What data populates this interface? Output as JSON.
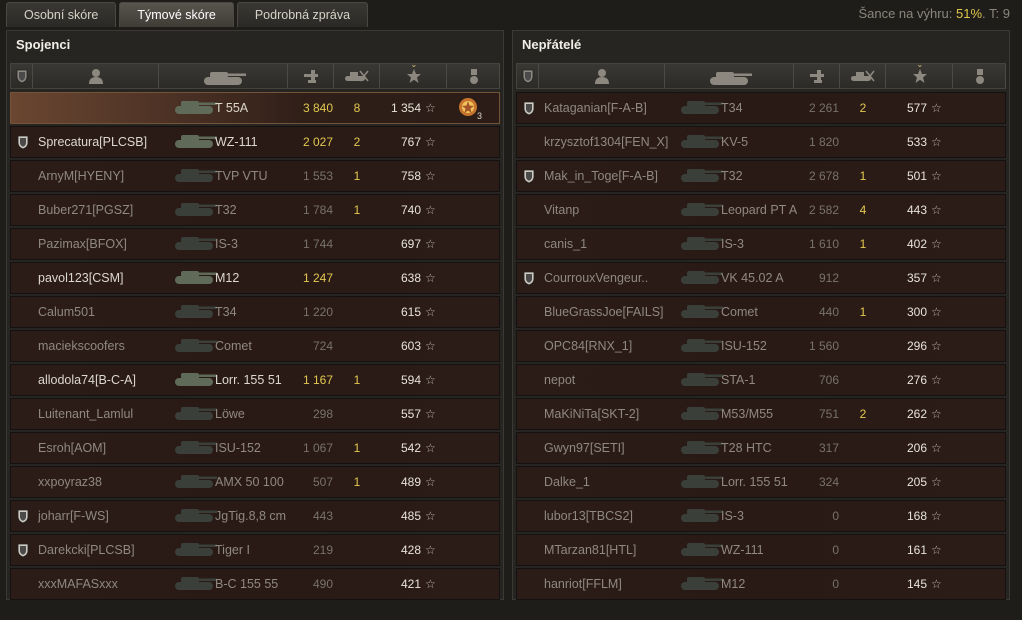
{
  "tabs": [
    {
      "label": "Osobní skóre",
      "active": false
    },
    {
      "label": "Týmové skóre",
      "active": true
    },
    {
      "label": "Podrobná zpráva",
      "active": false
    }
  ],
  "win_chance": {
    "label": "Šance na výhru: ",
    "value": "51%",
    "suffix": ". T: 9"
  },
  "left": {
    "title": "Spojenci",
    "rows": [
      {
        "name": "",
        "tank": "T 55A",
        "damage": "3 840",
        "kills": "8",
        "xp": "1 354",
        "clan_badge": false,
        "alive": true,
        "player": true,
        "medal": "3"
      },
      {
        "name": "Sprecatura[PLCSB]",
        "tank": "WZ-111",
        "damage": "2 027",
        "kills": "2",
        "xp": "767",
        "clan_badge": true,
        "alive": true
      },
      {
        "name": "ArnyM[HYENY]",
        "tank": "TVP VTU",
        "damage": "1 553",
        "kills": "1",
        "xp": "758",
        "clan_badge": false,
        "alive": false
      },
      {
        "name": "Buber271[PGSZ]",
        "tank": "T32",
        "damage": "1 784",
        "kills": "1",
        "xp": "740",
        "clan_badge": false,
        "alive": false
      },
      {
        "name": "Pazimax[BFOX]",
        "tank": "IS-3",
        "damage": "1 744",
        "kills": "",
        "xp": "697",
        "clan_badge": false,
        "alive": false
      },
      {
        "name": "pavol123[CSM]",
        "tank": "M12",
        "damage": "1 247",
        "kills": "",
        "xp": "638",
        "clan_badge": false,
        "alive": true
      },
      {
        "name": "Calum501",
        "tank": "T34",
        "damage": "1 220",
        "kills": "",
        "xp": "615",
        "clan_badge": false,
        "alive": false
      },
      {
        "name": "maciekscoofers",
        "tank": "Comet",
        "damage": "724",
        "kills": "",
        "xp": "603",
        "clan_badge": false,
        "alive": false
      },
      {
        "name": "allodola74[B-C-A]",
        "tank": "Lorr. 155 51",
        "damage": "1 167",
        "kills": "1",
        "xp": "594",
        "clan_badge": false,
        "alive": true
      },
      {
        "name": "Luitenant_Lamlul",
        "tank": "Löwe",
        "damage": "298",
        "kills": "",
        "xp": "557",
        "clan_badge": false,
        "alive": false
      },
      {
        "name": "Esroh[AOM]",
        "tank": "ISU-152",
        "damage": "1 067",
        "kills": "1",
        "xp": "542",
        "clan_badge": false,
        "alive": false
      },
      {
        "name": "xxpoyraz38",
        "tank": "AMX 50 100",
        "damage": "507",
        "kills": "1",
        "xp": "489",
        "clan_badge": false,
        "alive": false
      },
      {
        "name": "joharr[F-WS]",
        "tank": "JgTig.8,8 cm",
        "damage": "443",
        "kills": "",
        "xp": "485",
        "clan_badge": true,
        "alive": false
      },
      {
        "name": "Darekcki[PLCSB]",
        "tank": "Tiger I",
        "damage": "219",
        "kills": "",
        "xp": "428",
        "clan_badge": true,
        "alive": false
      },
      {
        "name": "xxxMAFASxxx",
        "tank": "B-C 155 55",
        "damage": "490",
        "kills": "",
        "xp": "421",
        "clan_badge": false,
        "alive": false
      }
    ]
  },
  "right": {
    "title": "Nepřátelé",
    "rows": [
      {
        "name": "Kataganian[F-A-B]",
        "tank": "T34",
        "damage": "2 261",
        "kills": "2",
        "xp": "577",
        "clan_badge": true,
        "alive": false
      },
      {
        "name": "krzysztof1304[FEN_X]",
        "tank": "KV-5",
        "damage": "1 820",
        "kills": "",
        "xp": "533",
        "clan_badge": false,
        "alive": false
      },
      {
        "name": "Mak_in_Toge[F-A-B]",
        "tank": "T32",
        "damage": "2 678",
        "kills": "1",
        "xp": "501",
        "clan_badge": true,
        "alive": false
      },
      {
        "name": "Vitanp",
        "tank": "Leopard PT A",
        "damage": "2 582",
        "kills": "4",
        "xp": "443",
        "clan_badge": false,
        "alive": false
      },
      {
        "name": "canis_1",
        "tank": "IS-3",
        "damage": "1 610",
        "kills": "1",
        "xp": "402",
        "clan_badge": false,
        "alive": false
      },
      {
        "name": "CourrouxVengeur..",
        "tank": "VK 45.02 A",
        "damage": "912",
        "kills": "",
        "xp": "357",
        "clan_badge": true,
        "alive": false
      },
      {
        "name": "BlueGrassJoe[FAILS]",
        "tank": "Comet",
        "damage": "440",
        "kills": "1",
        "xp": "300",
        "clan_badge": false,
        "alive": false
      },
      {
        "name": "OPC84[RNX_1]",
        "tank": "ISU-152",
        "damage": "1 560",
        "kills": "",
        "xp": "296",
        "clan_badge": false,
        "alive": false
      },
      {
        "name": "nepot",
        "tank": "STA-1",
        "damage": "706",
        "kills": "",
        "xp": "276",
        "clan_badge": false,
        "alive": false
      },
      {
        "name": "MaKiNiTa[SKT-2]",
        "tank": "M53/M55",
        "damage": "751",
        "kills": "2",
        "xp": "262",
        "clan_badge": false,
        "alive": false
      },
      {
        "name": "Gwyn97[SETI]",
        "tank": "T28 HTC",
        "damage": "317",
        "kills": "",
        "xp": "206",
        "clan_badge": false,
        "alive": false
      },
      {
        "name": "Dalke_1",
        "tank": "Lorr. 155 51",
        "damage": "324",
        "kills": "",
        "xp": "205",
        "clan_badge": false,
        "alive": false
      },
      {
        "name": "lubor13[TBCS2]",
        "tank": "IS-3",
        "damage": "0",
        "kills": "",
        "xp": "168",
        "clan_badge": false,
        "alive": false
      },
      {
        "name": "MTarzan81[HTL]",
        "tank": "WZ-111",
        "damage": "0",
        "kills": "",
        "xp": "161",
        "clan_badge": false,
        "alive": false
      },
      {
        "name": "hanriot[FFLM]",
        "tank": "M12",
        "damage": "0",
        "kills": "",
        "xp": "145",
        "clan_badge": false,
        "alive": false
      }
    ]
  },
  "icons": {
    "badge": "clan-badge-icon",
    "player": "player-icon",
    "tank": "tank-icon",
    "damage": "damage-icon",
    "kills": "kills-icon",
    "xp": "star-icon",
    "medals": "medal-icon",
    "sort": "sort-arrow-icon"
  },
  "colors": {
    "accent": "#e2c850",
    "alive_text": "#ddd8cd",
    "dead_text": "#8f897f"
  }
}
